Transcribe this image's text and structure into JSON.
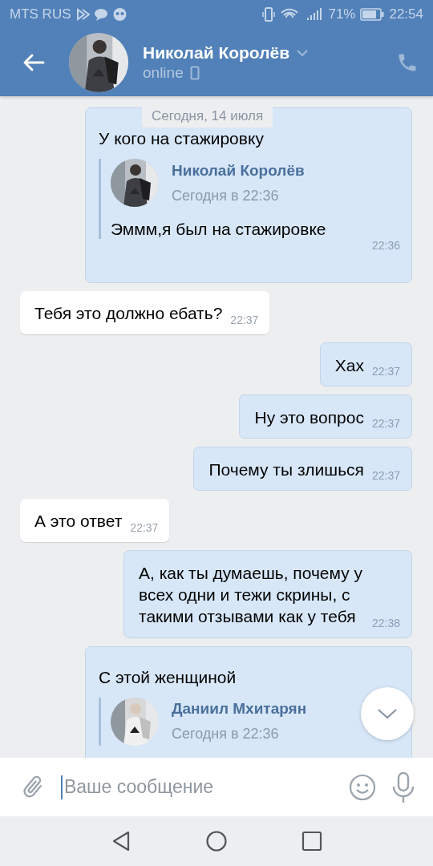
{
  "status_bar": {
    "carrier": "MTS RUS",
    "battery": "71%",
    "time": "22:54"
  },
  "header": {
    "name": "Николай Королёв",
    "status": "online"
  },
  "date_divider": "Сегодня, 14 июля",
  "messages": [
    {
      "kind": "out",
      "text": "У кого на стажировку",
      "time": "22:36",
      "forward": {
        "name": "Николай Королёв",
        "time": "Сегодня в 22:36",
        "text": "Эммм,я был на стажировке"
      }
    },
    {
      "kind": "in",
      "text": "Тебя это должно ебать?",
      "time": "22:37"
    },
    {
      "kind": "out",
      "text": "Хах",
      "time": "22:37"
    },
    {
      "kind": "out",
      "text": "Ну это вопрос",
      "time": "22:37"
    },
    {
      "kind": "out",
      "text": "Почему ты злишься",
      "time": "22:37"
    },
    {
      "kind": "in",
      "text": "А это ответ",
      "time": "22:37"
    },
    {
      "kind": "out",
      "text": "А, как ты думаешь, почему у всех одни и тежи скрины, с такими отзывами как у тебя",
      "time": "22:38"
    },
    {
      "kind": "out",
      "text": "С этой женщиной",
      "forward": {
        "name": "Даниил Мхитарян",
        "time": "Сегодня в 22:36"
      }
    }
  ],
  "composer": {
    "placeholder": "Ваше сообщение"
  }
}
